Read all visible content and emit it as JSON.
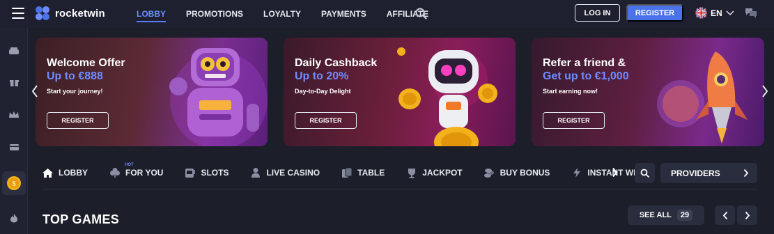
{
  "header": {
    "logo_text": "rocketwin",
    "nav": [
      {
        "label": "LOBBY",
        "active": true
      },
      {
        "label": "PROMOTIONS",
        "active": false
      },
      {
        "label": "LOYALTY",
        "active": false
      },
      {
        "label": "PAYMENTS",
        "active": false
      },
      {
        "label": "AFFILIATE",
        "active": false
      }
    ],
    "login_label": "LOG IN",
    "register_label": "REGISTER",
    "language": "EN",
    "accent_color": "#4a72ea"
  },
  "sidebar": {
    "icons": [
      "lobby-icon",
      "gift-icon",
      "crown-icon",
      "wallet-icon",
      "coin-icon",
      "flame-icon"
    ]
  },
  "banners": [
    {
      "title": "Welcome Offer",
      "subtitle": "Up to €888",
      "description": "Start your journey!",
      "button": "REGISTER"
    },
    {
      "title": "Daily Cashback",
      "subtitle": "Up to 20%",
      "description": "Day-to-Day Delight",
      "button": "REGISTER"
    },
    {
      "title": "Refer a friend &",
      "subtitle": "Get up to €1,000",
      "description": "Start earning now!",
      "button": "REGISTER"
    }
  ],
  "categories": [
    {
      "label": "LOBBY",
      "icon": "home-icon"
    },
    {
      "label": "FOR YOU",
      "icon": "clover-icon",
      "badge": "HOT"
    },
    {
      "label": "SLOTS",
      "icon": "slot-machine-icon"
    },
    {
      "label": "LIVE CASINO",
      "icon": "dealer-icon"
    },
    {
      "label": "TABLE",
      "icon": "cards-icon"
    },
    {
      "label": "JACKPOT",
      "icon": "trophy-icon"
    },
    {
      "label": "BUY BONUS",
      "icon": "coins-icon"
    },
    {
      "label": "INSTANT WIN",
      "icon": "lightning-icon"
    }
  ],
  "providers_label": "PROVIDERS",
  "section": {
    "title": "TOP GAMES",
    "see_all": "SEE ALL",
    "count": "29"
  }
}
